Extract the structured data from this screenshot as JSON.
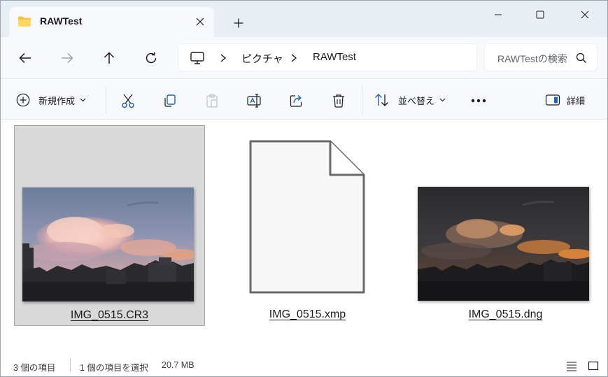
{
  "window": {
    "tab_title": "RAWTest",
    "controls": {
      "minimize": "minimize",
      "maximize": "maximize",
      "close": "close"
    }
  },
  "address": {
    "breadcrumbs": [
      "ピクチャ",
      "RAWTest"
    ],
    "search_placeholder": "RAWTestの検索"
  },
  "toolbar": {
    "new_label": "新規作成",
    "sort_label": "並べ替え",
    "details_label": "詳細",
    "icons": [
      "cut-icon",
      "copy-icon",
      "paste-icon",
      "rename-icon",
      "share-icon",
      "delete-icon",
      "more-icon"
    ]
  },
  "files": [
    {
      "name": "IMG_0515.CR3",
      "kind": "raw-photo-thumbnail",
      "selected": true
    },
    {
      "name": "IMG_0515.xmp",
      "kind": "generic-file-icon",
      "selected": false
    },
    {
      "name": "IMG_0515.dng",
      "kind": "dng-photo-thumbnail",
      "selected": false
    }
  ],
  "status": {
    "item_count": "3 個の項目",
    "selection": "1 個の項目を選択",
    "size": "20.7 MB"
  },
  "colors": {
    "accent": "#0067c0",
    "folder": "#f4c542",
    "selection_bg": "#d9d9d9"
  }
}
